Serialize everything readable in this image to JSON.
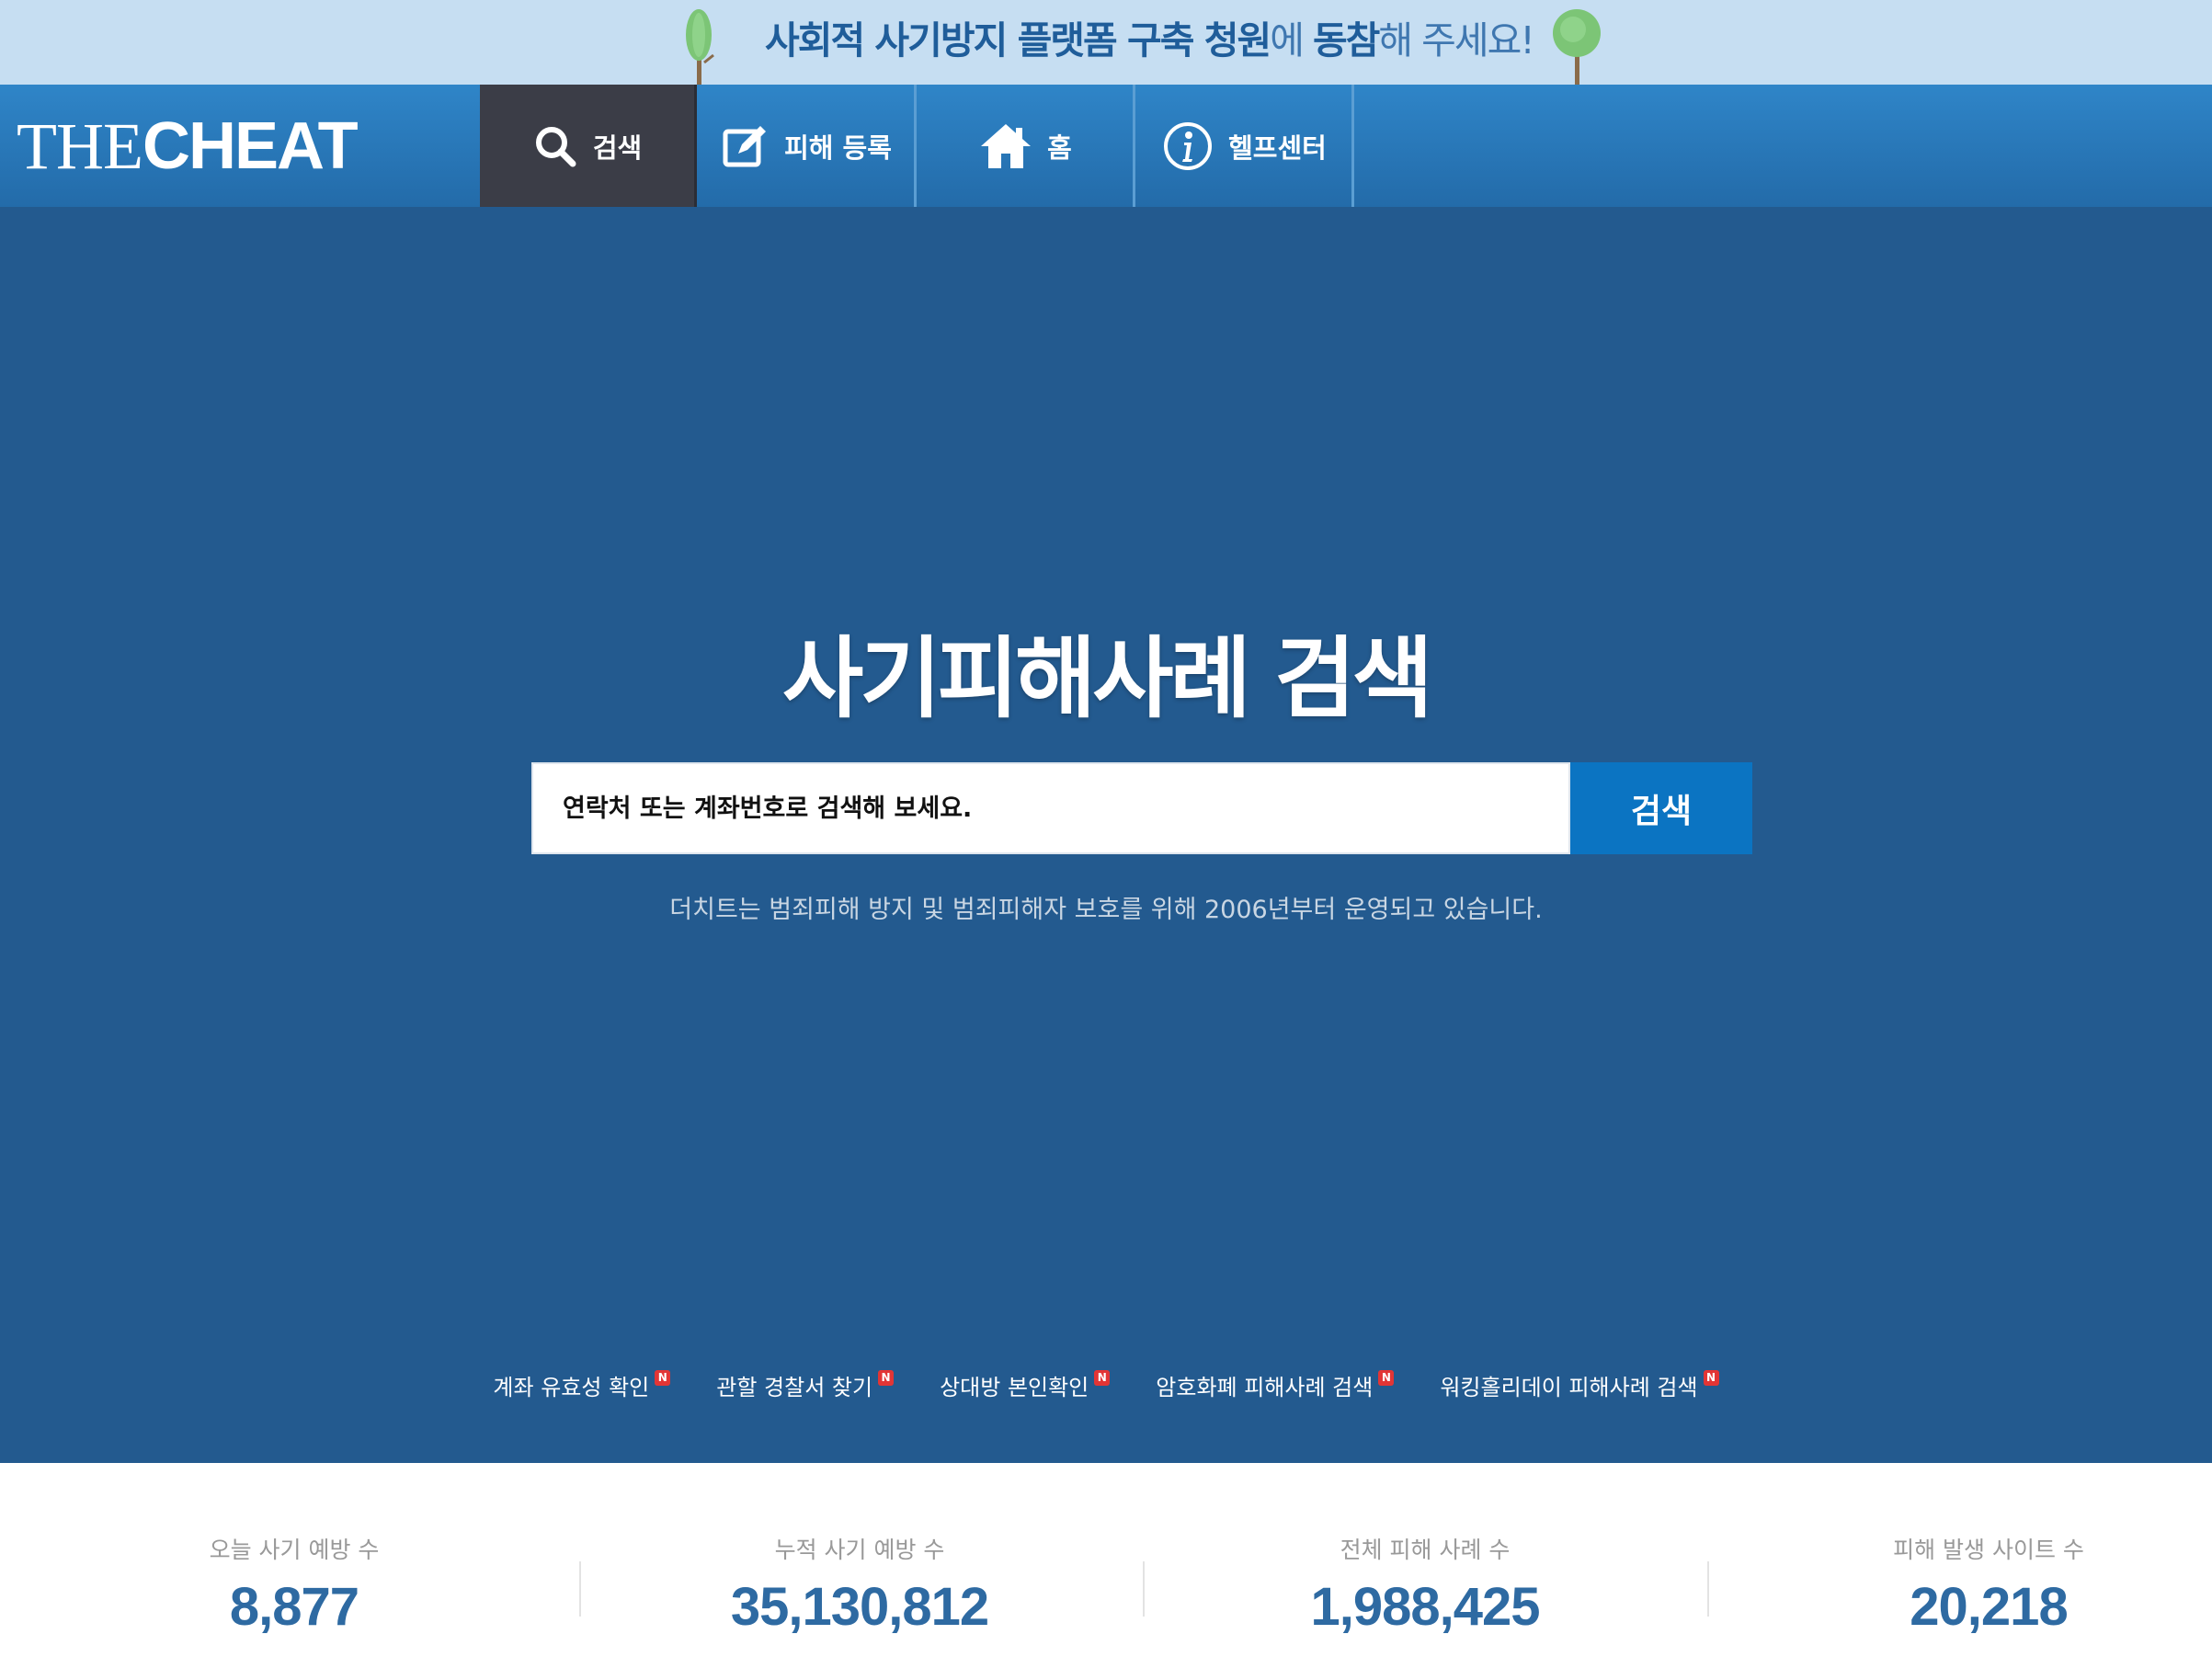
{
  "banner": {
    "text_bold_1": "사회적 사기방지 플랫폼 구축 청원",
    "text_light_1": "에 ",
    "text_bold_2": "동참",
    "text_light_2": "해 주세요!"
  },
  "header": {
    "logo_light": "THE",
    "logo_bold": "CHEAT"
  },
  "nav": {
    "items": [
      {
        "label": "검색",
        "icon": "search-icon",
        "active": true
      },
      {
        "label": "피해 등록",
        "icon": "edit-icon"
      },
      {
        "label": "홈",
        "icon": "home-icon"
      },
      {
        "label": "헬프센터",
        "icon": "info-icon"
      }
    ]
  },
  "hero": {
    "title": "사기피해사례 검색",
    "search_placeholder": "연락처 또는 계좌번호로 검색해 보세요.",
    "search_button": "검색",
    "subtitle": "더치트는 범죄피해 방지 및 범죄피해자 보호를 위해 2006년부터 운영되고 있습니다."
  },
  "quick_links": [
    {
      "label": "계좌 유효성 확인",
      "badge": "N"
    },
    {
      "label": "관할 경찰서 찾기",
      "badge": "N"
    },
    {
      "label": "상대방 본인확인",
      "badge": "N"
    },
    {
      "label": "암호화폐 피해사례 검색",
      "badge": "N"
    },
    {
      "label": "워킹홀리데이 피해사례 검색",
      "badge": "N"
    }
  ],
  "stats": [
    {
      "label": "오늘 사기 예방 수",
      "value": "8,877"
    },
    {
      "label": "누적 사기 예방 수",
      "value": "35,130,812"
    },
    {
      "label": "전체 피해 사례 수",
      "value": "1,988,425"
    },
    {
      "label": "피해 발생 사이트 수",
      "value": "20,218"
    }
  ],
  "colors": {
    "banner_bg": "#c6def2",
    "nav_bg": "#2a7abb",
    "nav_active_bg": "#3b3d47",
    "hero_bg": "#235a8f",
    "search_button_bg": "#0b74c2",
    "stat_value": "#2e6aa2",
    "badge": "#e23535"
  }
}
